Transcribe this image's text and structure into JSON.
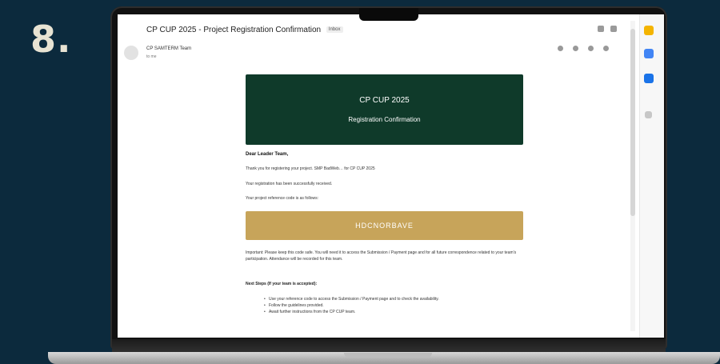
{
  "step_number": "8.",
  "email": {
    "subject": "CP CUP 2025 - Project Registration Confirmation",
    "subject_tag": "Inbox",
    "sender_name": "CP SAMTERM Team",
    "sender_email": "",
    "recipient": "to me",
    "date": ""
  },
  "banner": {
    "title": "CP CUP 2025",
    "subtitle": "Registration Confirmation",
    "color": "#0f3a2a"
  },
  "body": {
    "greeting": "Dear Leader Team,",
    "line1": "Thank you for registering your project. SMP BadWeb… for CP CUP 2025",
    "line2": "Your registration has been successfully received.",
    "line3": "Your project reference code is as follows:",
    "reference_code": "HDCNORBAVE",
    "reference_color": "#c7a45a",
    "important_note": "Important: Please keep this code safe. You will need it to access the Submission / Payment page and for all future correspondence related to your team's participation. Attendance will be recorded for this team.",
    "next_steps_title": "Next Steps (If your team is accepted):",
    "next_steps": [
      "Use your reference code to access the Submission / Payment page and to check the availability.",
      "Follow the guidelines provided.",
      "Await further instructions from the CP CUP team."
    ]
  },
  "sidebar_icons": [
    "calendar-icon",
    "keep-icon",
    "tasks-icon",
    "add-icon"
  ]
}
